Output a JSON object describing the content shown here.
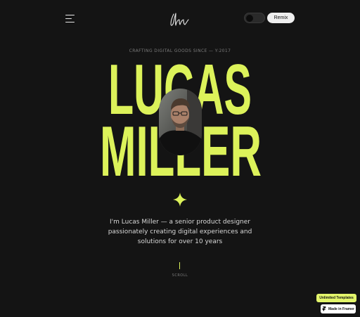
{
  "header": {
    "menu_icon": "hamburger-menu-icon",
    "logo_icon": "signature-logo-icon",
    "theme_toggle_icon": "dark-mode-toggle",
    "remix_label": "Remix"
  },
  "hero": {
    "tagline": "CRAFTING DIGITAL GOODS SINCE — Y:2017",
    "first_name": "LUCAS",
    "last_name": "MILLER",
    "portrait_icon": "portrait-photo",
    "divider_icon": "sparkle-star-icon",
    "bio_lines": [
      "I'm Lucas Miller — a senior product designer",
      "passionately creating digital experiences and",
      "solutions for over 10 years"
    ],
    "scroll_label": "SCROLL"
  },
  "badges": {
    "templates_label": "Unlimited Templates",
    "framer_label": "Made in Framer",
    "framer_icon": "framer-logo-icon"
  },
  "colors": {
    "background": "#141414",
    "accent": "#dcf25a",
    "text": "#d9d9d9",
    "muted": "#7a7a7a"
  }
}
